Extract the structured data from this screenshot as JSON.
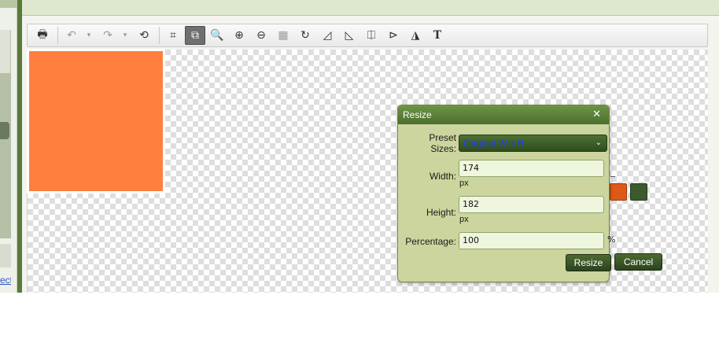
{
  "app": {
    "left_link_text": "ect"
  },
  "toolbar": {
    "items": [
      {
        "icon": "print-icon",
        "glyph": "🖶"
      },
      {
        "icon": "undo-icon",
        "glyph": "↶"
      },
      {
        "icon": "undo-dropdown-icon",
        "glyph": "▾"
      },
      {
        "icon": "redo-icon",
        "glyph": "↷"
      },
      {
        "icon": "redo-dropdown-icon",
        "glyph": "▾"
      },
      {
        "icon": "reset-icon",
        "glyph": "⟲"
      },
      {
        "icon": "crop-icon",
        "glyph": "⌗"
      },
      {
        "icon": "resize-icon",
        "glyph": "⧉"
      },
      {
        "icon": "zoom-icon",
        "glyph": "🔍"
      },
      {
        "icon": "zoom-in-icon",
        "glyph": "⊕"
      },
      {
        "icon": "zoom-out-icon",
        "glyph": "⊖"
      },
      {
        "icon": "fit-icon",
        "glyph": "▦"
      },
      {
        "icon": "rotate-icon",
        "glyph": "↻"
      },
      {
        "icon": "skew-left-icon",
        "glyph": "◿"
      },
      {
        "icon": "skew-right-icon",
        "glyph": "◺"
      },
      {
        "icon": "flip-vertical-icon",
        "glyph": "⎅"
      },
      {
        "icon": "perspective-icon",
        "glyph": "⊳"
      },
      {
        "icon": "flip-horizontal-icon",
        "glyph": "◮"
      },
      {
        "icon": "text-icon",
        "glyph": "T"
      }
    ]
  },
  "image": {
    "fill_color": "#ff7f3f"
  },
  "resize_dialog": {
    "title": "Resize",
    "close_glyph": "✕",
    "preset_label_line1": "Preset",
    "preset_label_line2": "Sizes:",
    "preset_value": "Original W x H",
    "preset_chevron": "⌄",
    "width_label": "Width:",
    "width_value": "174",
    "width_unit": "px",
    "height_label": "Height:",
    "height_value": "182",
    "height_unit": "px",
    "percentage_label": "Percentage:",
    "percentage_value": "100",
    "percentage_unit": "%",
    "resize_button": "Resize",
    "cancel_button": "Cancel"
  },
  "colors": {
    "accent_green": "#4b6e2d",
    "dialog_bg": "#cbd59d",
    "handle_orange": "#dd5a16"
  }
}
